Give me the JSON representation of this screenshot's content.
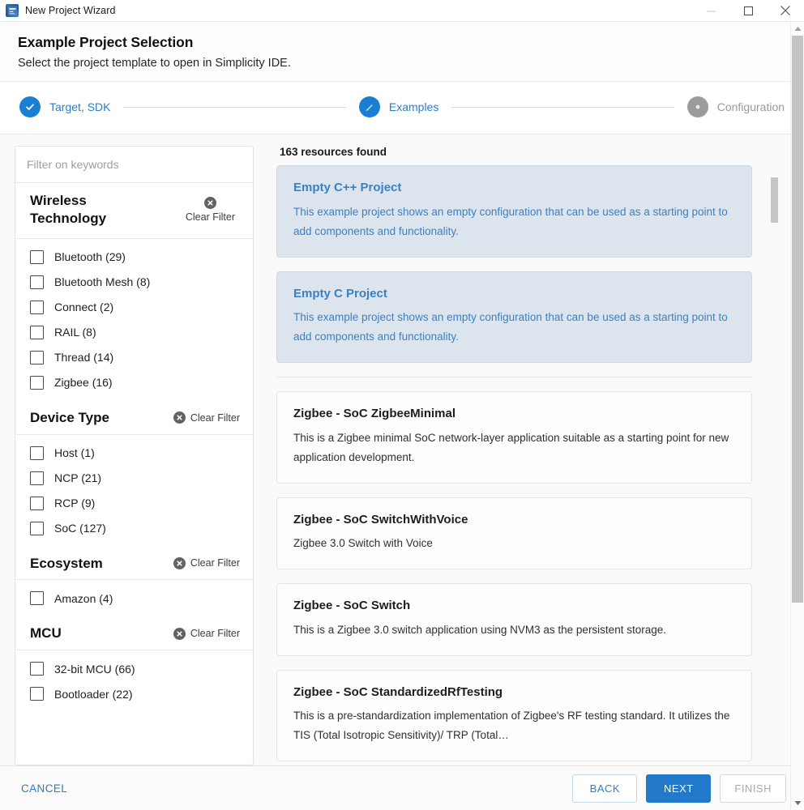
{
  "window": {
    "title": "New Project Wizard",
    "icon": "app-icon",
    "controls": {
      "minimize": "minimize-icon",
      "maximize": "maximize-icon",
      "close": "close-icon"
    }
  },
  "header": {
    "title": "Example Project Selection",
    "subtitle": "Select the project template to open in Simplicity IDE."
  },
  "stepper": {
    "steps": [
      {
        "label": "Target, SDK",
        "state": "done",
        "icon": "check-icon"
      },
      {
        "label": "Examples",
        "state": "active",
        "icon": "pencil-icon"
      },
      {
        "label": "Configuration",
        "state": "todo",
        "icon": "dot-icon"
      }
    ]
  },
  "sidebar": {
    "search": {
      "placeholder": "Filter on keywords",
      "value": ""
    },
    "clear_filter_label": "Clear Filter",
    "facets": [
      {
        "title": "Wireless Technology",
        "layout": "stacked",
        "items": [
          {
            "label": "Bluetooth (29)",
            "checked": false
          },
          {
            "label": "Bluetooth Mesh (8)",
            "checked": false
          },
          {
            "label": "Connect (2)",
            "checked": false
          },
          {
            "label": "RAIL (8)",
            "checked": false
          },
          {
            "label": "Thread (14)",
            "checked": false
          },
          {
            "label": "Zigbee (16)",
            "checked": false
          }
        ]
      },
      {
        "title": "Device Type",
        "layout": "inline",
        "items": [
          {
            "label": "Host (1)",
            "checked": false
          },
          {
            "label": "NCP (21)",
            "checked": false
          },
          {
            "label": "RCP (9)",
            "checked": false
          },
          {
            "label": "SoC (127)",
            "checked": false
          }
        ]
      },
      {
        "title": "Ecosystem",
        "layout": "inline",
        "items": [
          {
            "label": "Amazon (4)",
            "checked": false
          }
        ]
      },
      {
        "title": "MCU",
        "layout": "inline",
        "items": [
          {
            "label": "32-bit MCU (66)",
            "checked": false
          },
          {
            "label": "Bootloader (22)",
            "checked": false
          }
        ]
      }
    ]
  },
  "results": {
    "count_label": "163 resources found",
    "cards": [
      {
        "title": "Empty C++ Project",
        "description": "This example project shows an empty configuration that can be used as a starting point to add components and functionality.",
        "selected": true
      },
      {
        "title": "Empty C Project",
        "description": "This example project shows an empty configuration that can be used as a starting point to add components and functionality.",
        "selected": true
      },
      {
        "title": "Zigbee - SoC ZigbeeMinimal",
        "description": "This is a Zigbee minimal SoC network-layer application suitable as a starting point for new application development.",
        "selected": false
      },
      {
        "title": "Zigbee - SoC SwitchWithVoice",
        "description": "Zigbee 3.0 Switch with Voice",
        "selected": false
      },
      {
        "title": "Zigbee - SoC Switch",
        "description": "This is a Zigbee 3.0 switch application using NVM3 as the persistent storage.",
        "selected": false
      },
      {
        "title": "Zigbee - SoC StandardizedRfTesting",
        "description": "This is a pre-standardization implementation of Zigbee's RF testing standard. It utilizes the TIS (Total Isotropic Sensitivity)/ TRP (Total…",
        "selected": false
      }
    ]
  },
  "footer": {
    "cancel_label": "CANCEL",
    "back_label": "BACK",
    "next_label": "NEXT",
    "finish_label": "FINISH"
  },
  "colors": {
    "accent": "#2379c9",
    "link": "#2b7ec4",
    "selected_card_bg": "#dce5ed",
    "step_done": "#1a7fd4",
    "step_todo": "#9b9b9b"
  }
}
